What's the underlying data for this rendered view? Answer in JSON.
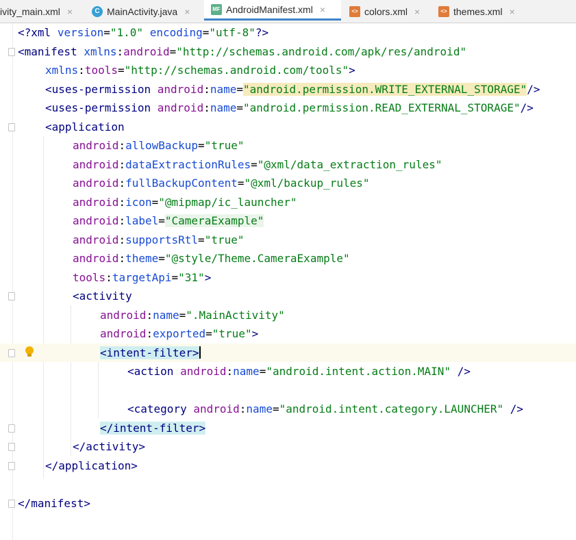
{
  "tabs": [
    {
      "label": "ivity_main.xml",
      "icon": "xml-file-icon",
      "active": false
    },
    {
      "label": "MainActivity.java",
      "icon": "java-class-icon",
      "active": false
    },
    {
      "label": "AndroidManifest.xml",
      "icon": "manifest-file-icon",
      "active": true
    },
    {
      "label": "colors.xml",
      "icon": "xml-file-icon",
      "active": false
    },
    {
      "label": "themes.xml",
      "icon": "xml-file-icon",
      "active": false
    }
  ],
  "tab_close_glyph": "×",
  "icon_labels": {
    "java": "C",
    "manifest": "MF",
    "xml": "<>"
  },
  "code": {
    "l1_tag": "<?xml",
    "l1_a1": "version",
    "l1_v1": "\"1.0\"",
    "l1_a2": "encoding",
    "l1_v2": "\"utf-8\"",
    "l1_end": "?>",
    "manifest_open": "<manifest",
    "xmlns": "xmlns",
    "android": "android",
    "tools": "tools",
    "android_uri": "\"http://schemas.android.com/apk/res/android\"",
    "tools_uri": "\"http://schemas.android.com/tools\"",
    "uses_permission": "<uses-permission",
    "name": "name",
    "perm_write": "\"android.permission.WRITE_EXTERNAL_STORAGE\"",
    "perm_read": "\"android.permission.READ_EXTERNAL_STORAGE\"",
    "application_open": "<application",
    "allowBackup": "allowBackup",
    "allowBackup_v": "\"true\"",
    "dataExtractionRules": "dataExtractionRules",
    "dataExtractionRules_v": "\"@xml/data_extraction_rules\"",
    "fullBackupContent": "fullBackupContent",
    "fullBackupContent_v": "\"@xml/backup_rules\"",
    "icon": "icon",
    "icon_v": "\"@mipmap/ic_launcher\"",
    "label": "label",
    "label_v": "\"CameraExample\"",
    "supportsRtl": "supportsRtl",
    "supportsRtl_v": "\"true\"",
    "theme": "theme",
    "theme_v": "\"@style/Theme.CameraExample\"",
    "targetApi": "targetApi",
    "targetApi_v": "\"31\"",
    "activity_open": "<activity",
    "activity_name_v": "\".MainActivity\"",
    "exported": "exported",
    "exported_v": "\"true\"",
    "intent_filter_open": "<intent-filter>",
    "action_open": "<action",
    "action_v": "\"android.intent.action.MAIN\"",
    "category_open": "<category",
    "category_v": "\"android.intent.category.LAUNCHER\"",
    "intent_filter_close": "</intent-filter>",
    "activity_close": "</activity>",
    "application_close": "</application>",
    "manifest_close": "</manifest>"
  },
  "colors": {
    "tag": "#000080",
    "namespace": "#871094",
    "attribute": "#174ad4",
    "string": "#067d17",
    "accent": "#4083c9"
  }
}
